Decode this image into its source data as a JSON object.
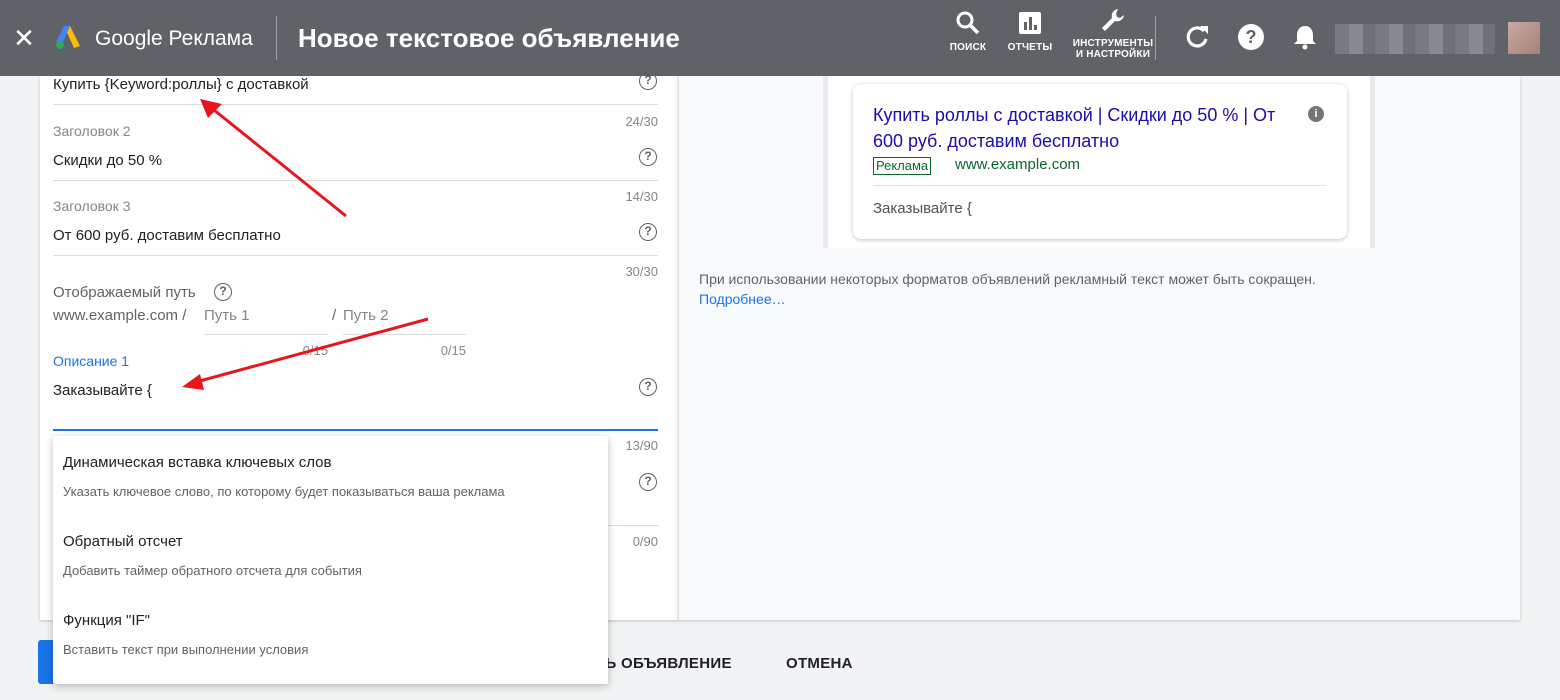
{
  "header": {
    "brand": "Google Реклама",
    "title": "Новое текстовое объявление",
    "tools": [
      {
        "label": "ПОИСК",
        "icon": "search-icon"
      },
      {
        "label": "ОТЧЕТЫ",
        "icon": "reports-icon"
      },
      {
        "label_line1": "ИНСТРУМЕНТЫ",
        "label_line2": "И НАСТРОЙКИ",
        "icon": "wrench-icon"
      }
    ],
    "icons": [
      "close-icon",
      "google-ads-logo-icon",
      "refresh-icon",
      "help-icon",
      "bell-icon"
    ]
  },
  "form": {
    "headline1_value": "Купить {Keyword:роллы} с доставкой",
    "headline2_label": "Заголовок 2",
    "headline2_counter": "24/30",
    "headline2_value": "Скидки до 50 %",
    "headline3_label": "Заголовок 3",
    "headline3_counter": "14/30",
    "headline3_value": "От 600 руб. доставим бесплатно",
    "headline3_counter_after": "30/30",
    "path_label": "Отображаемый путь",
    "path_base": "www.example.com /",
    "path1_placeholder": "Путь 1",
    "path2_prefix": "/",
    "path2_placeholder": "Путь 2",
    "path1_counter": "0/15",
    "path2_counter": "0/15",
    "desc1_label": "Описание 1",
    "desc1_value": "Заказывайте {",
    "desc1_counter": "13/90",
    "desc2_counter": "0/90"
  },
  "dropdown": {
    "items": [
      {
        "title": "Динамическая вставка ключевых слов",
        "desc": "Указать ключевое слово, по которому будет показываться ваша реклама"
      },
      {
        "title": "Обратный отсчет",
        "desc": "Добавить таймер обратного отсчета для события"
      },
      {
        "title": "Функция \"IF\"",
        "desc": "Вставить текст при выполнении условия"
      }
    ]
  },
  "preview": {
    "headline": "Купить роллы с доставкой | Скидки до 50 % | От 600 руб. доставим бесплатно",
    "badge": "Реклама",
    "url": "www.example.com",
    "description": "Заказывайте {",
    "note": "При использовании некоторых форматов объявлений рекламный текст может быть сокращен.",
    "more_link": "Подробнее…"
  },
  "buttons": {
    "save_partial": "ТЬ ОБЪЯВЛЕНИЕ",
    "cancel": "ОТМЕНА"
  },
  "colors": {
    "header_bg": "#5f6368",
    "accent_blue": "#1a73e8",
    "ad_link": "#1a0dab",
    "ad_green": "#0d652d",
    "arrow_red": "#e8161b"
  }
}
